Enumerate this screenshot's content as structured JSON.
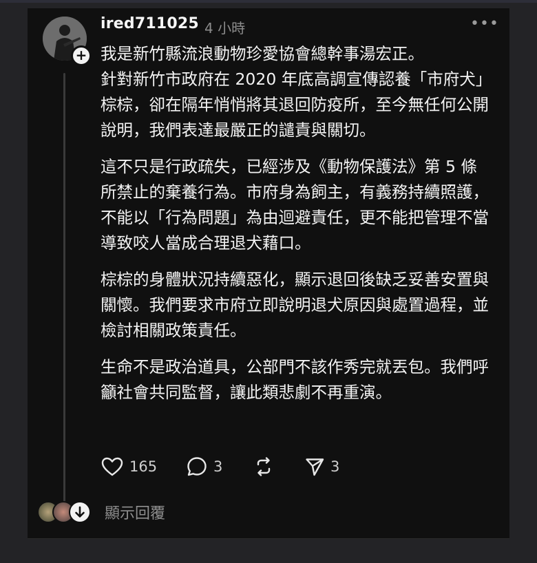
{
  "post": {
    "username": "ired711025",
    "time": "4 小時",
    "more_label": "•••",
    "follow_label": "+",
    "paragraphs": [
      "我是新竹縣流浪動物珍愛協會總幹事湯宏正。\n針對新竹市政府在 2020 年底高調宣傳認養「市府犬」棕棕，卻在隔年悄悄將其退回防疫所，至今無任何公開說明，我們表達最嚴正的譴責與關切。",
      "這不只是行政疏失，已經涉及《動物保護法》第 5 條所禁止的棄養行為。市府身為飼主，有義務持續照護，不能以「行為問題」為由迴避責任，更不能把管理不當導致咬人當成合理退犬藉口。",
      "棕棕的身體狀況持續惡化，顯示退回後缺乏妥善安置與關懷。我們要求市府立即說明退犬原因與處置過程，並檢討相關政策責任。",
      "生命不是政治道具，公部門不該作秀完就丟包。我們呼籲社會共同監督，讓此類悲劇不再重演。"
    ]
  },
  "actions": {
    "likes": "165",
    "comments": "3",
    "reposts": "",
    "shares": "3"
  },
  "replies": {
    "label": "顯示回覆"
  },
  "icons": {
    "like": "heart-icon",
    "comment": "comment-bubble-icon",
    "repost": "repost-icon",
    "share": "send-icon",
    "more": "more-dots-icon",
    "expand": "arrow-down-icon"
  },
  "colors": {
    "card_bg": "#101010",
    "page_bg": "#232326",
    "text": "#f3f3f3",
    "muted": "#8d8d8d"
  }
}
